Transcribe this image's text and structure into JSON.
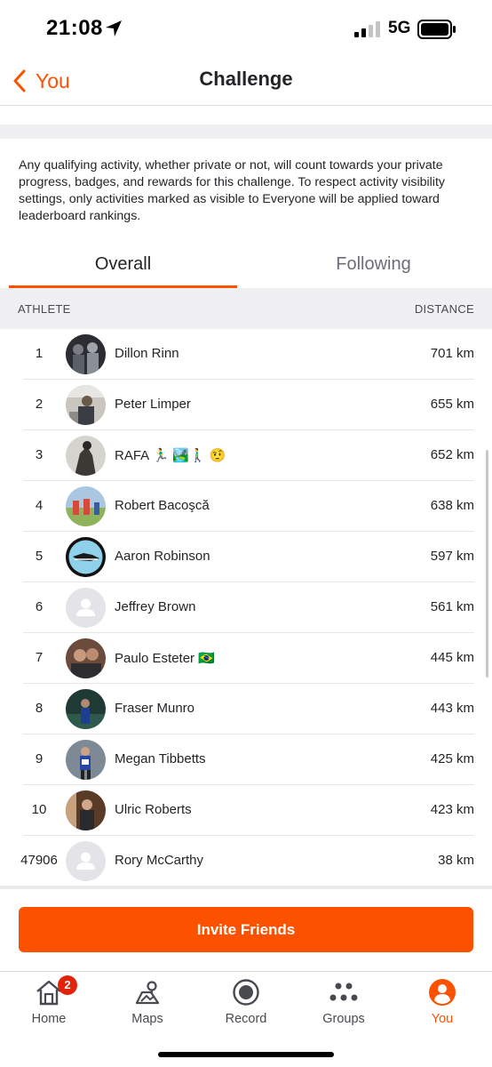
{
  "status_bar": {
    "time": "21:08",
    "network": "5G"
  },
  "nav": {
    "back_label": "You",
    "title": "Challenge"
  },
  "disclaimer": "Any qualifying activity, whether private or not, will count towards your private progress, badges, and rewards for this challenge. To respect activity visibility settings, only activities marked as visible to Everyone will be applied toward leaderboard rankings.",
  "tabs": [
    {
      "label": "Overall",
      "selected": true
    },
    {
      "label": "Following",
      "selected": false
    }
  ],
  "table": {
    "col_athlete": "ATHLETE",
    "col_distance": "DISTANCE",
    "rows": [
      {
        "rank": "1",
        "name": "Dillon Rinn",
        "distance": "701 km",
        "avatar": "photo"
      },
      {
        "rank": "2",
        "name": "Peter Limper",
        "distance": "655 km",
        "avatar": "photo"
      },
      {
        "rank": "3",
        "name": "RAFA 🏃‍♂️ 🏞️🚶‍♂️ 🤨",
        "distance": "652 km",
        "avatar": "photo"
      },
      {
        "rank": "4",
        "name": "Robert Bacoşcă",
        "distance": "638 km",
        "avatar": "photo"
      },
      {
        "rank": "5",
        "name": "Aaron Robinson",
        "distance": "597 km",
        "avatar": "photo"
      },
      {
        "rank": "6",
        "name": "Jeffrey Brown",
        "distance": "561 km",
        "avatar": "placeholder"
      },
      {
        "rank": "7",
        "name": "Paulo Esteter 🇧🇷",
        "distance": "445 km",
        "avatar": "photo"
      },
      {
        "rank": "8",
        "name": "Fraser Munro",
        "distance": "443 km",
        "avatar": "photo"
      },
      {
        "rank": "9",
        "name": "Megan Tibbetts",
        "distance": "425 km",
        "avatar": "photo"
      },
      {
        "rank": "10",
        "name": "Ulric Roberts",
        "distance": "423 km",
        "avatar": "photo"
      },
      {
        "rank": "47906",
        "name": "Rory McCarthy",
        "distance": "38 km",
        "avatar": "placeholder"
      }
    ]
  },
  "invite_button": "Invite Friends",
  "tab_bar": {
    "items": [
      {
        "label": "Home",
        "icon": "home-icon"
      },
      {
        "label": "Maps",
        "icon": "maps-icon"
      },
      {
        "label": "Record",
        "icon": "record-icon"
      },
      {
        "label": "Groups",
        "icon": "groups-icon"
      },
      {
        "label": "You",
        "icon": "profile-icon",
        "selected": true
      }
    ],
    "home_badge": "2"
  },
  "colors": {
    "accent": "#fc5200",
    "text": "#242428",
    "muted": "#6d6d78",
    "badge": "#e3220a"
  }
}
